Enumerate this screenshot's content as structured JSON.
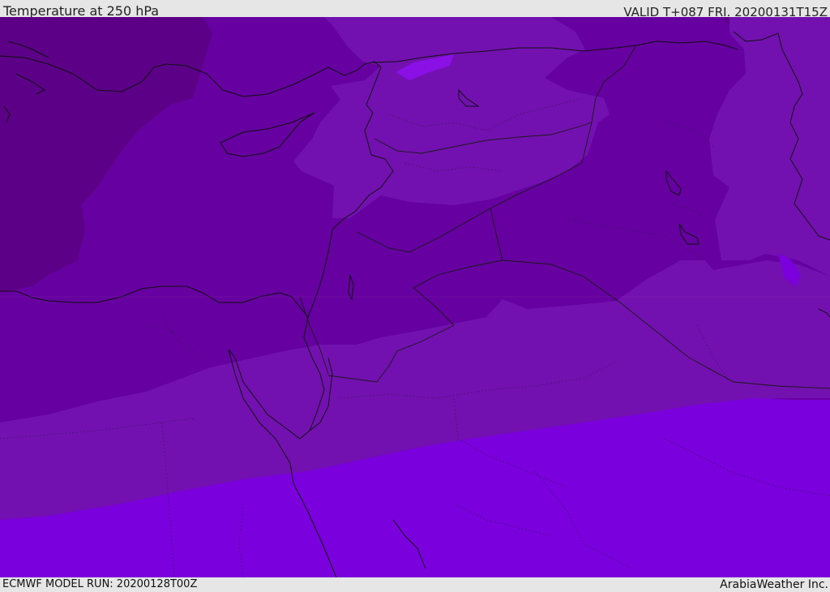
{
  "header": {
    "title": "Temperature at 250 hPa",
    "valid": "VALID T+087 FRI. 20200131T15Z"
  },
  "footer": {
    "model_run": "ECMWF MODEL RUN: 20200128T00Z",
    "credit": "ArabiaWeather Inc."
  },
  "colors": {
    "band_coldest": "#5c0088",
    "band_cold": "#6600a0",
    "band_mid": "#7310b0",
    "band_warm": "#7a00dd",
    "band_spot": "#8a10e6",
    "coast": "#111111",
    "border": "#1a1a1a"
  }
}
